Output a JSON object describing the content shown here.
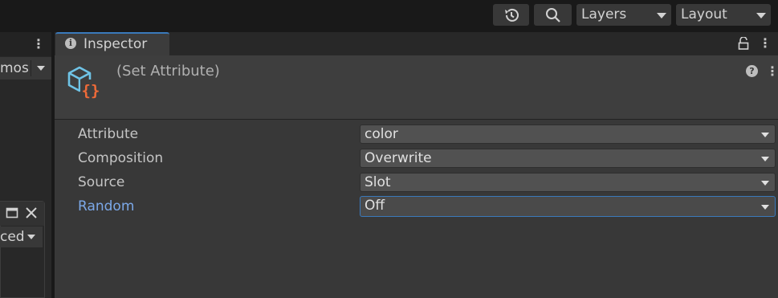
{
  "toolbar": {
    "history_icon": "history-icon",
    "search_icon": "search-icon",
    "layers_label": "Layers",
    "layout_label": "Layout"
  },
  "left_panel": {
    "dropdown_label": "mos",
    "sub_dropdown_label": "ced"
  },
  "inspector": {
    "tab_label": "Inspector",
    "title": "(Set Attribute)",
    "properties": [
      {
        "label": "Attribute",
        "value": "color"
      },
      {
        "label": "Composition",
        "value": "Overwrite"
      },
      {
        "label": "Source",
        "value": "Slot"
      },
      {
        "label": "Random",
        "value": "Off"
      }
    ]
  },
  "colors": {
    "accent": "#3a79bb",
    "active_label": "#7ba8e8",
    "icon_cube": "#6fc3e6",
    "icon_braces": "#ee6a38"
  }
}
